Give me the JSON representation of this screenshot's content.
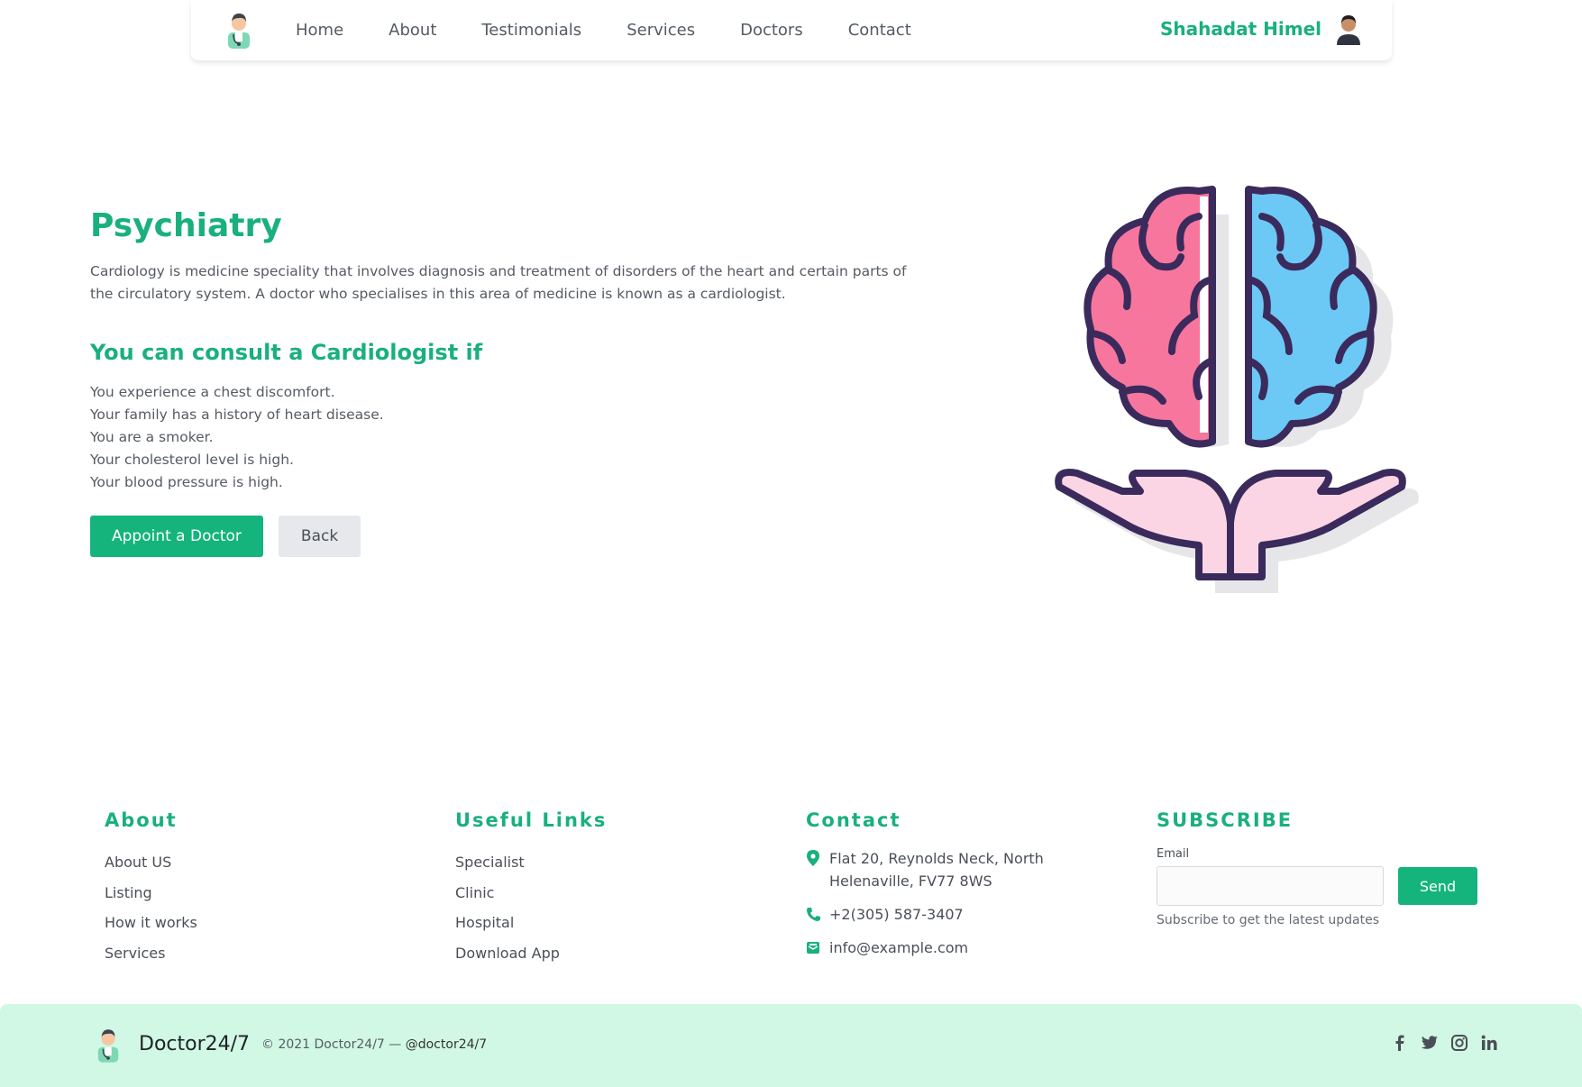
{
  "nav": {
    "links": [
      "Home",
      "About",
      "Testimonials",
      "Services",
      "Doctors",
      "Contact"
    ],
    "username": "Shahadat Himel"
  },
  "hero": {
    "title": "Psychiatry",
    "description": "Cardiology is medicine speciality that involves diagnosis and treatment of disorders of the heart and certain parts of the circulatory system. A doctor who specialises in this area of medicine is known as a cardiologist.",
    "consult_title": "You can consult a Cardiologist if",
    "conditions": [
      "You experience a chest discomfort.",
      "Your family has a history of heart disease.",
      "You are a smoker.",
      "Your cholesterol level is high.",
      "Your blood pressure is high."
    ],
    "appoint_label": "Appoint a Doctor",
    "back_label": "Back"
  },
  "footer": {
    "about": {
      "title": "About",
      "links": [
        "About US",
        "Listing",
        "How it works",
        "Services"
      ]
    },
    "useful": {
      "title": "Useful Links",
      "links": [
        "Specialist",
        "Clinic",
        "Hospital",
        "Download App"
      ]
    },
    "contact": {
      "title": "Contact",
      "address": "Flat 20, Reynolds Neck, North Helenaville, FV77 8WS",
      "phone": "+2(305) 587-3407",
      "email": "info@example.com"
    },
    "subscribe": {
      "title": "SUBSCRIBE",
      "email_label": "Email",
      "send_label": "Send",
      "note": "Subscribe to get the latest updates"
    }
  },
  "bottom": {
    "brand": "Doctor24/7",
    "copyright": "© 2021 Doctor24/7 — ",
    "handle": "@doctor24/7",
    "socials": [
      "facebook-icon",
      "twitter-icon",
      "instagram-icon",
      "linkedin-icon"
    ]
  },
  "colors": {
    "accent": "#19b07c",
    "button": "#15b47d",
    "bottom_bar": "#d1f8e5",
    "brain_left": "#f7769d",
    "brain_right": "#6cc8f5",
    "hands": "#fcd5e5",
    "outline": "#3b2a5c"
  }
}
